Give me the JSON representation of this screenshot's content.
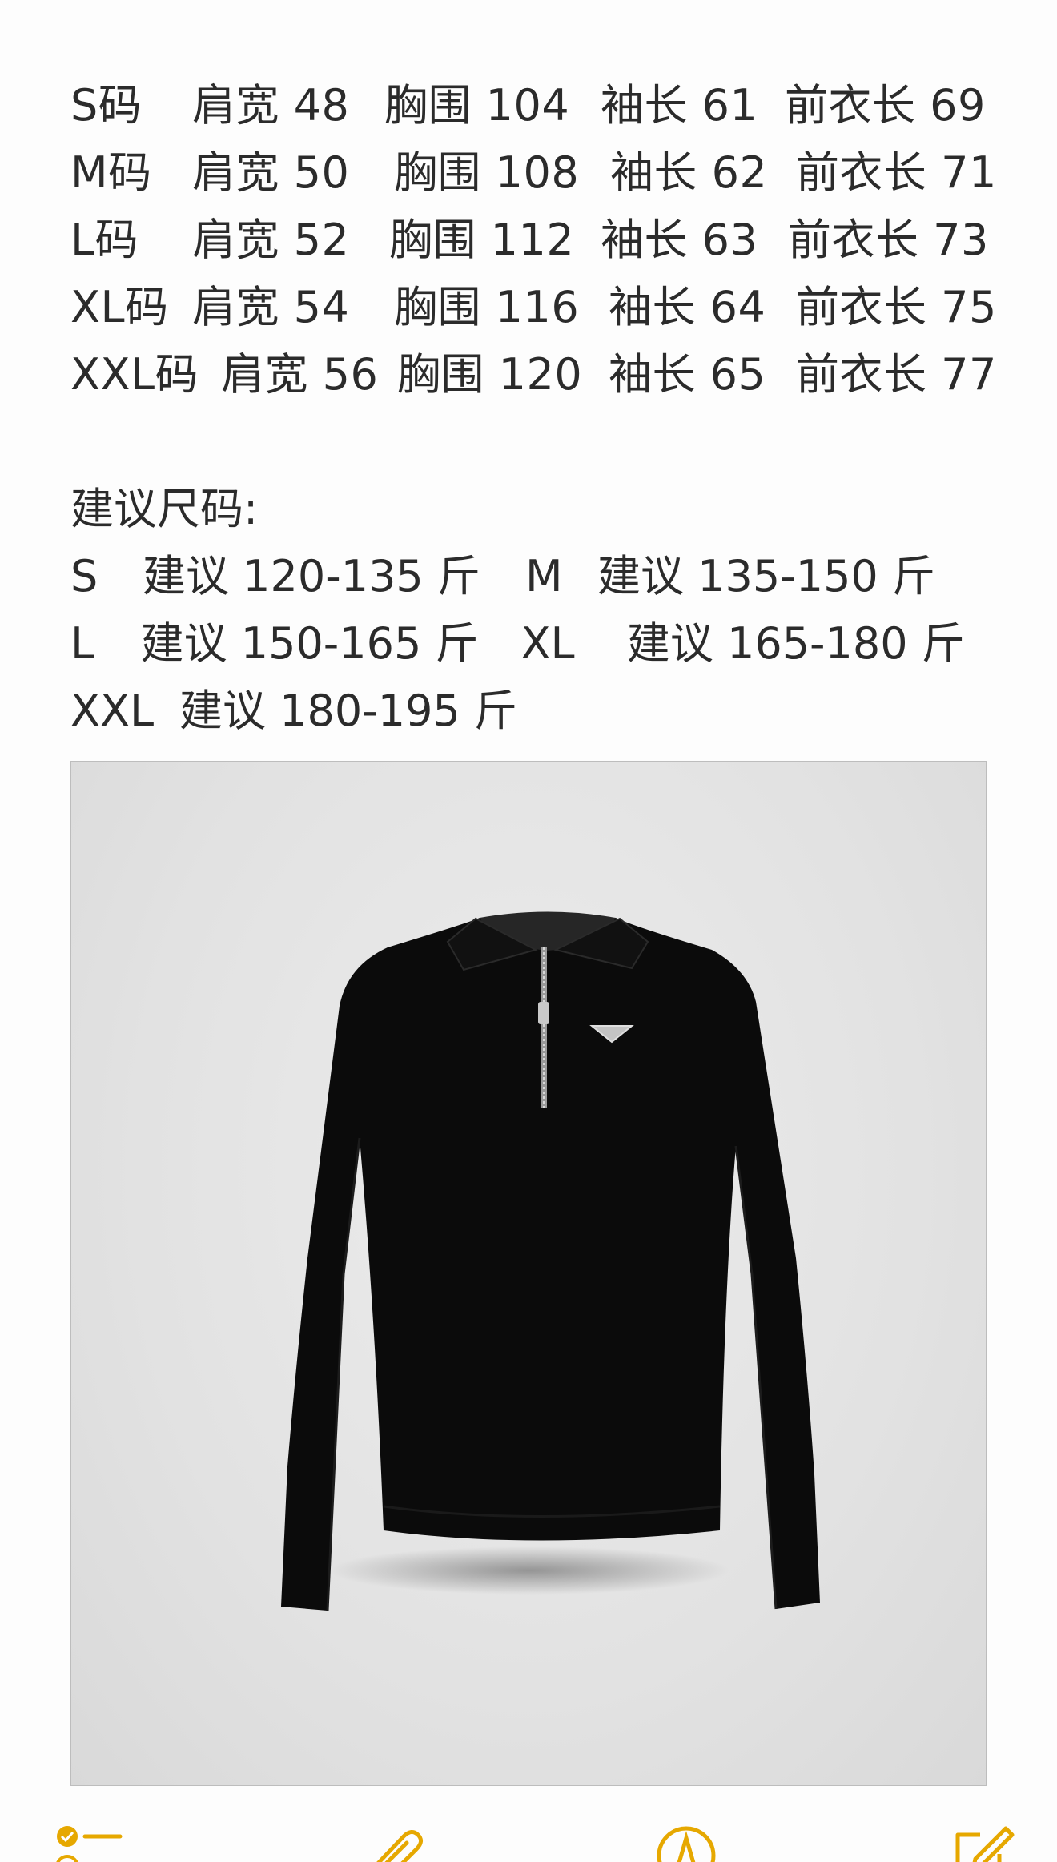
{
  "sizes": {
    "rows": [
      {
        "size": "S码",
        "shoulder": "肩宽 48",
        "chest": "胸围 104",
        "sleeve": "袖长 61",
        "length": "前衣长 69"
      },
      {
        "size": "M码",
        "shoulder": "肩宽 50",
        "chest": "胸围 108",
        "sleeve": "袖长 62",
        "length": "前衣长 71"
      },
      {
        "size": "L码",
        "shoulder": "肩宽 52",
        "chest": "胸围 112",
        "sleeve": "袖长 63",
        "length": "前衣长 73"
      },
      {
        "size": "XL码",
        "shoulder": "肩宽 54",
        "chest": "胸围 116",
        "sleeve": "袖长 64",
        "length": "前衣长 75"
      },
      {
        "size": "XXL码",
        "shoulder": "肩宽 56",
        "chest": "胸围 120",
        "sleeve": "袖长 65",
        "length": "前衣长 77"
      }
    ]
  },
  "recommend": {
    "title": "建议尺码:",
    "rows": [
      [
        {
          "size": "S",
          "range": "建议 120-135 斤"
        },
        {
          "size": "M",
          "range": "建议 135-150 斤"
        }
      ],
      [
        {
          "size": "L",
          "range": "建议 150-165 斤"
        },
        {
          "size": "XL",
          "range": "建议 165-180 斤"
        }
      ],
      [
        {
          "size": "XXL",
          "range": "建议 180-195 斤"
        }
      ]
    ]
  },
  "toolbar": {
    "accent_color": "#e6a800",
    "icons": [
      "checklist-icon",
      "attachment-icon",
      "markup-icon",
      "compose-icon"
    ]
  },
  "photo": {
    "background_color": "#e4e4e4",
    "garment_color": "#0c0c0c"
  }
}
